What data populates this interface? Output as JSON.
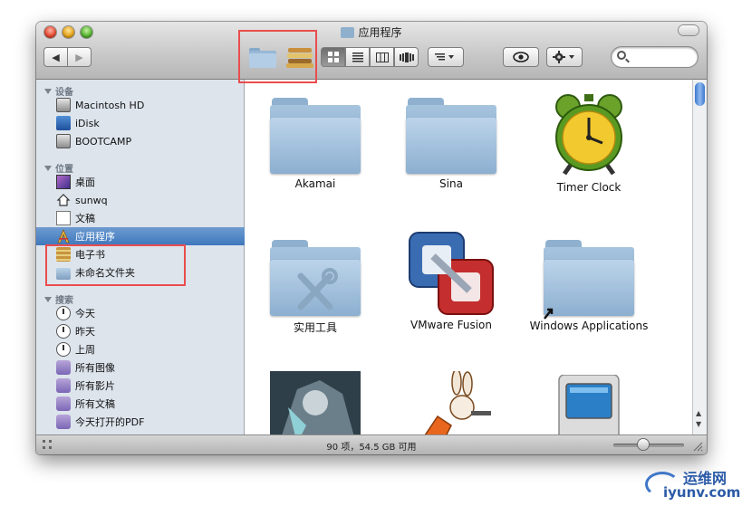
{
  "window": {
    "title": "应用程序"
  },
  "sidebar": {
    "sections": [
      {
        "header": "设备",
        "items": [
          "Macintosh HD",
          "iDisk",
          "BOOTCAMP"
        ]
      },
      {
        "header": "位置",
        "items": [
          "桌面",
          "sunwq",
          "文稿",
          "应用程序",
          "电子书",
          "未命名文件夹"
        ]
      },
      {
        "header": "搜索",
        "items": [
          "今天",
          "昨天",
          "上周",
          "所有图像",
          "所有影片",
          "所有文稿",
          "今天打开的PDF"
        ]
      }
    ],
    "selected": "应用程序"
  },
  "content": {
    "items": [
      {
        "label": "Akamai",
        "icon": "folder-icon"
      },
      {
        "label": "Sina",
        "icon": "folder-icon"
      },
      {
        "label": "Timer Clock",
        "icon": "alarm-clock-icon"
      },
      {
        "label": "实用工具",
        "icon": "utilities-folder-icon"
      },
      {
        "label": "VMware Fusion",
        "icon": "vmware-fusion-icon"
      },
      {
        "label": "Windows Applications",
        "icon": "folder-alias-icon"
      },
      {
        "label": "",
        "icon": "game-art-icon"
      },
      {
        "label": "",
        "icon": "rabbit-game-icon"
      },
      {
        "label": "",
        "icon": "classic-mac-icon"
      }
    ]
  },
  "status": {
    "text": "90 项，54.5 GB 可用"
  },
  "watermark": {
    "cn": "运维网",
    "en": "iyunv.com"
  },
  "colors": {
    "selection": "#3f78bd",
    "sidebar_bg": "#dde4ec",
    "highlight_box": "#ea4d4d"
  }
}
